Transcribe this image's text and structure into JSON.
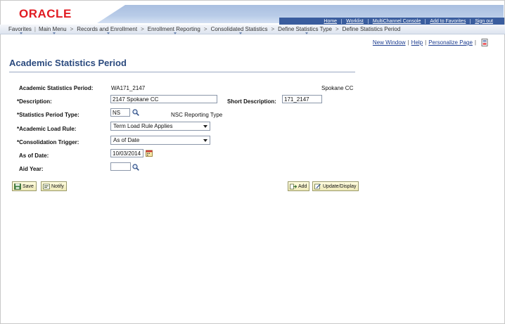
{
  "header": {
    "logo": "ORACLE",
    "links": [
      "Home",
      "Worklist",
      "MultiChannel Console",
      "Add to Favorites",
      "Sign out"
    ]
  },
  "breadcrumb": {
    "favorites": "Favorites",
    "main_menu": "Main Menu",
    "items": [
      "Records and Enrollment",
      "Enrollment Reporting",
      "Consolidated Statistics",
      "Define Statistics Type",
      "Define Statistics Period"
    ]
  },
  "page_links": {
    "new_window": "New Window",
    "help": "Help",
    "personalize": "Personalize Page"
  },
  "page": {
    "title": "Academic Statistics Period"
  },
  "form": {
    "period_label": "Academic Statistics Period:",
    "period_value": "WA171_2147",
    "institution_value": "Spokane CC",
    "description_label": "*Description:",
    "description_value": "2147 Spokane CC",
    "short_description_label": "Short Description:",
    "short_description_value": "171_2147",
    "stat_period_type_label": "*Statistics Period Type:",
    "stat_period_type_value": "NS",
    "stat_period_type_desc": "NSC Reporting Type",
    "academic_load_rule_label": "*Academic Load Rule:",
    "academic_load_rule_value": "Term Load Rule Applies",
    "consolidation_trigger_label": "*Consolidation Trigger:",
    "consolidation_trigger_value": "As of Date",
    "as_of_date_label": "As of Date:",
    "as_of_date_value": "10/03/2014",
    "aid_year_label": "Aid Year:",
    "aid_year_value": ""
  },
  "buttons": {
    "save": "Save",
    "notify": "Notify",
    "add": "Add",
    "update_display": "Update/Display"
  },
  "colors": {
    "oracle_red": "#e11b22",
    "title_blue": "#2b4a7e",
    "link_blue": "#1d3d90"
  }
}
